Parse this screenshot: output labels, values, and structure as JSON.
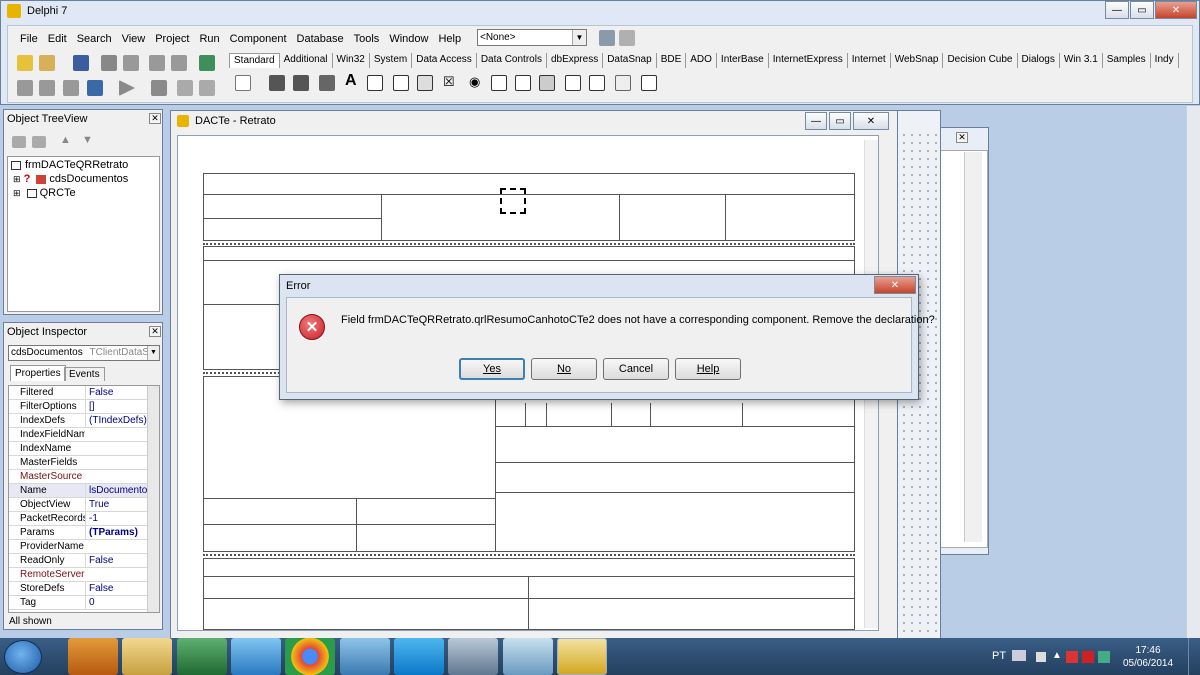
{
  "ide": {
    "title": "Delphi 7",
    "menu": [
      "File",
      "Edit",
      "Search",
      "View",
      "Project",
      "Run",
      "Component",
      "Database",
      "Tools",
      "Window",
      "Help"
    ],
    "combo_value": "<None>",
    "palette_tabs": [
      "Standard",
      "Additional",
      "Win32",
      "System",
      "Data Access",
      "Data Controls",
      "dbExpress",
      "DataSnap",
      "BDE",
      "ADO",
      "InterBase",
      "InternetExpress",
      "Internet",
      "WebSnap",
      "Decision Cube",
      "Dialogs",
      "Win 3.1",
      "Samples",
      "Indy"
    ]
  },
  "tree_view": {
    "title": "Object TreeView",
    "items": [
      "frmDACTeQRRetrato",
      "cdsDocumentos",
      "QRCTe"
    ]
  },
  "inspector": {
    "title": "Object Inspector",
    "selected": "cdsDocumentos",
    "selected_type": "TClientDataSet",
    "tabs": [
      "Properties",
      "Events"
    ],
    "rows": [
      {
        "k": "Filtered",
        "v": "False"
      },
      {
        "k": "FilterOptions",
        "v": "[]"
      },
      {
        "k": "IndexDefs",
        "v": "(TIndexDefs)"
      },
      {
        "k": "IndexFieldNames",
        "v": ""
      },
      {
        "k": "IndexName",
        "v": ""
      },
      {
        "k": "MasterFields",
        "v": ""
      },
      {
        "k": "MasterSource",
        "v": ""
      },
      {
        "k": "Name",
        "v": "lsDocumentos"
      },
      {
        "k": "ObjectView",
        "v": "True"
      },
      {
        "k": "PacketRecords",
        "v": "-1"
      },
      {
        "k": "Params",
        "v": "(TParams)"
      },
      {
        "k": "ProviderName",
        "v": ""
      },
      {
        "k": "ReadOnly",
        "v": "False"
      },
      {
        "k": "RemoteServer",
        "v": ""
      },
      {
        "k": "StoreDefs",
        "v": "False"
      },
      {
        "k": "Tag",
        "v": "0"
      }
    ],
    "status": "All shown"
  },
  "form": {
    "title": "DACTe - Retrato"
  },
  "dialog": {
    "title": "Error",
    "message": "Field frmDACTeQRRetrato.qrlResumoCanhotoCTe2 does not have a corresponding component. Remove the declaration?",
    "buttons": [
      "Yes",
      "No",
      "Cancel",
      "Help"
    ]
  },
  "taskbar": {
    "lang": "PT",
    "time": "17:46",
    "date": "05/06/2014"
  },
  "colors": {
    "accent": "#3c7fb1",
    "error": "#c8202a"
  }
}
